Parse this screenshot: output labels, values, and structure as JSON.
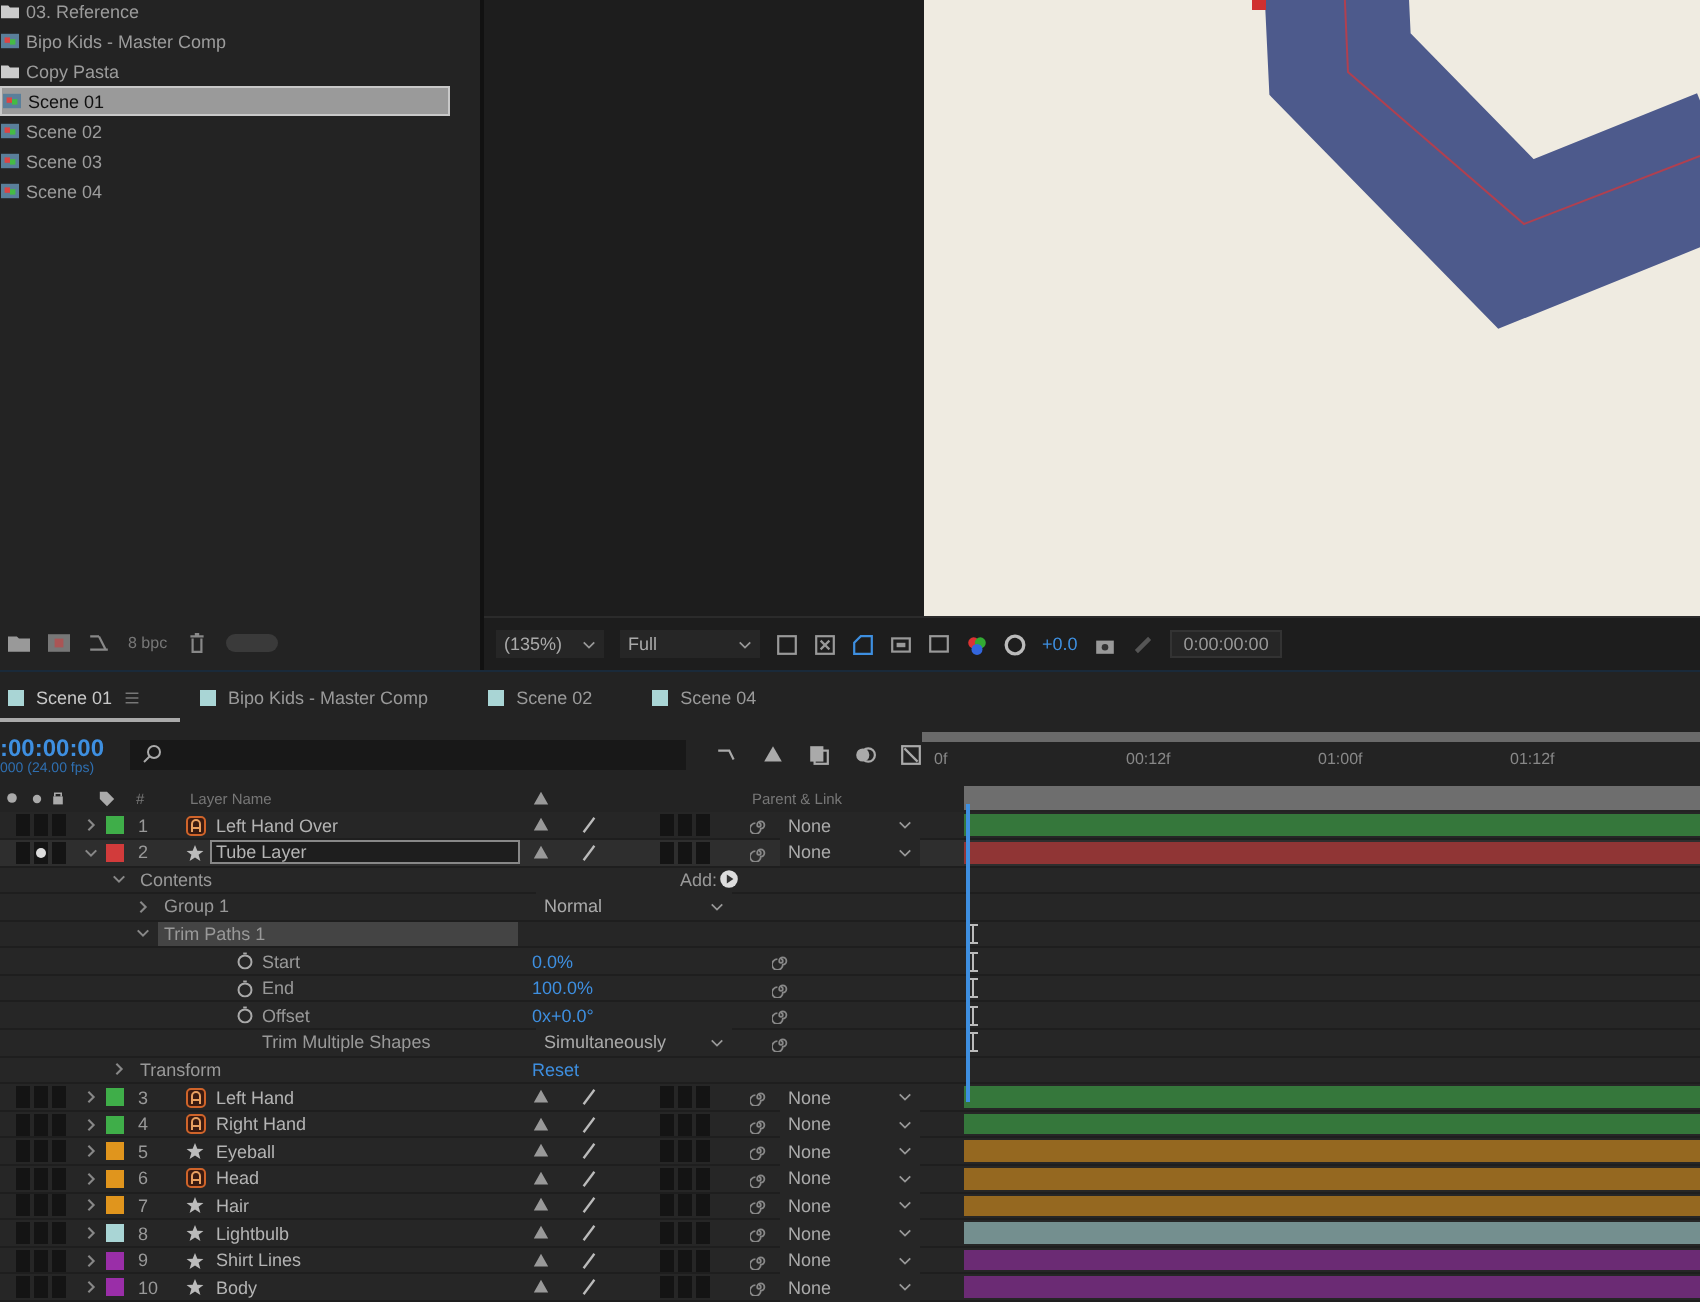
{
  "project": {
    "items": [
      {
        "name": "03. Reference",
        "kind": "folder",
        "selected": false
      },
      {
        "name": "Bipo Kids - Master Comp",
        "kind": "comp",
        "selected": false
      },
      {
        "name": "Copy Pasta",
        "kind": "folder",
        "selected": false
      },
      {
        "name": "Scene 01",
        "kind": "comp",
        "selected": true
      },
      {
        "name": "Scene 02",
        "kind": "comp",
        "selected": false
      },
      {
        "name": "Scene 03",
        "kind": "comp",
        "selected": false
      },
      {
        "name": "Scene 04",
        "kind": "comp",
        "selected": false
      }
    ],
    "bpc": "8 bpc"
  },
  "viewer": {
    "zoom": "(135%)",
    "resolution": "Full",
    "exposure": "+0.0",
    "timecode": "0:00:00:00"
  },
  "timeline": {
    "tabs": [
      {
        "label": "Scene 01",
        "selected": true
      },
      {
        "label": "Bipo Kids - Master Comp",
        "selected": false
      },
      {
        "label": "Scene 02",
        "selected": false
      },
      {
        "label": "Scene 04",
        "selected": false
      }
    ],
    "timecode": ":00:00:00",
    "fps": "000 (24.00 fps)",
    "columns": {
      "number": "#",
      "name": "Layer Name",
      "parent": "Parent & Link"
    },
    "ruler": [
      "0f",
      "00:12f",
      "01:00f",
      "01:12f"
    ],
    "rows": [
      {
        "kind": "layer",
        "number": "1",
        "name": "Left Hand Over",
        "precomp": true,
        "color": "#3fae49",
        "selected": false,
        "solo": false,
        "expanded": false,
        "parent": "None"
      },
      {
        "kind": "layer",
        "number": "2",
        "name": "Tube Layer",
        "precomp": false,
        "color": "#d23b3b",
        "selected": true,
        "solo": true,
        "expanded": true,
        "parent": "None",
        "children": [
          {
            "kind": "group",
            "name": "Contents",
            "expanded": true,
            "add": "Add:",
            "children": [
              {
                "kind": "group",
                "name": "Group 1",
                "expanded": false,
                "dropdown": "Normal"
              },
              {
                "kind": "group",
                "name": "Trim Paths 1",
                "expanded": true,
                "selected": true,
                "children": [
                  {
                    "kind": "property",
                    "name": "Start",
                    "value": "0.0%"
                  },
                  {
                    "kind": "property",
                    "name": "End",
                    "value": "100.0%"
                  },
                  {
                    "kind": "property",
                    "name": "Offset",
                    "value": "0x+0.0°"
                  },
                  {
                    "kind": "option",
                    "name": "Trim Multiple Shapes",
                    "dropdown": "Simultaneously"
                  }
                ]
              }
            ]
          },
          {
            "kind": "group",
            "name": "Transform",
            "expanded": false,
            "link": "Reset"
          }
        ]
      },
      {
        "kind": "layer",
        "number": "3",
        "name": "Left Hand",
        "precomp": true,
        "color": "#3fae49",
        "selected": false,
        "solo": false,
        "expanded": false,
        "parent": "None"
      },
      {
        "kind": "layer",
        "number": "4",
        "name": "Right Hand",
        "precomp": true,
        "color": "#3fae49",
        "selected": false,
        "solo": false,
        "expanded": false,
        "parent": "None"
      },
      {
        "kind": "layer",
        "number": "5",
        "name": "Eyeball",
        "precomp": false,
        "color": "#e0951d",
        "selected": false,
        "solo": false,
        "expanded": false,
        "parent": "None"
      },
      {
        "kind": "layer",
        "number": "6",
        "name": "Head",
        "precomp": true,
        "color": "#e0951d",
        "selected": false,
        "solo": false,
        "expanded": false,
        "parent": "None"
      },
      {
        "kind": "layer",
        "number": "7",
        "name": "Hair",
        "precomp": false,
        "color": "#e0951d",
        "selected": false,
        "solo": false,
        "expanded": false,
        "parent": "None"
      },
      {
        "kind": "layer",
        "number": "8",
        "name": "Lightbulb",
        "precomp": false,
        "color": "#a9d5d5",
        "selected": false,
        "solo": false,
        "expanded": false,
        "parent": "None"
      },
      {
        "kind": "layer",
        "number": "9",
        "name": "Shirt Lines",
        "precomp": false,
        "color": "#9a2ea8",
        "selected": false,
        "solo": false,
        "expanded": false,
        "parent": "None"
      },
      {
        "kind": "layer",
        "number": "10",
        "name": "Body",
        "precomp": false,
        "color": "#9a2ea8",
        "selected": false,
        "solo": false,
        "expanded": false,
        "parent": "None"
      }
    ]
  }
}
